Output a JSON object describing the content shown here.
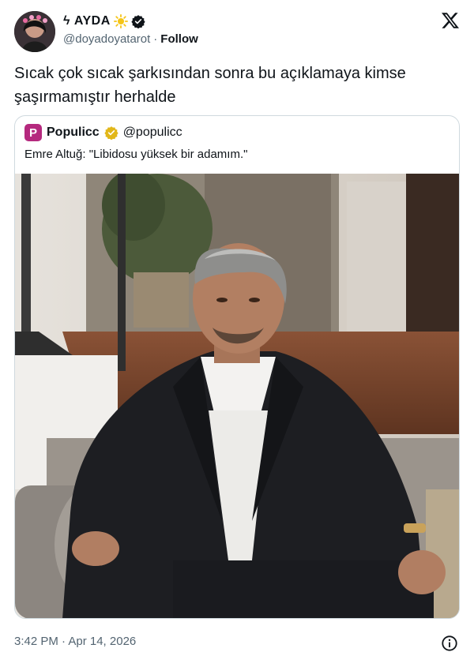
{
  "author": {
    "display_name": "ϟ AYDA",
    "handle": "@doyadoyatarot",
    "separator": "·",
    "follow_label": "Follow"
  },
  "icons": {
    "sun": "sun-icon",
    "verified": "verified-badge-icon",
    "platform": "x-logo-icon",
    "info": "info-icon"
  },
  "tweet": {
    "text": "Sıcak çok sıcak şarkısından sonra bu açıklamaya kimse şaşırmamıştır herhalde"
  },
  "quote": {
    "logo_letter": "P",
    "name": "Populicc",
    "handle": "@populicc",
    "text": "Emre Altuğ: \"Libidosu yüksek bir adamım.\""
  },
  "footer": {
    "timestamp": "3:42 PM · Apr 14, 2026"
  },
  "colors": {
    "brand_magenta": "#b5297e",
    "gold_check": "#e2b719",
    "text_primary": "#0f1419",
    "text_secondary": "#536471",
    "border": "#cfd9de"
  }
}
